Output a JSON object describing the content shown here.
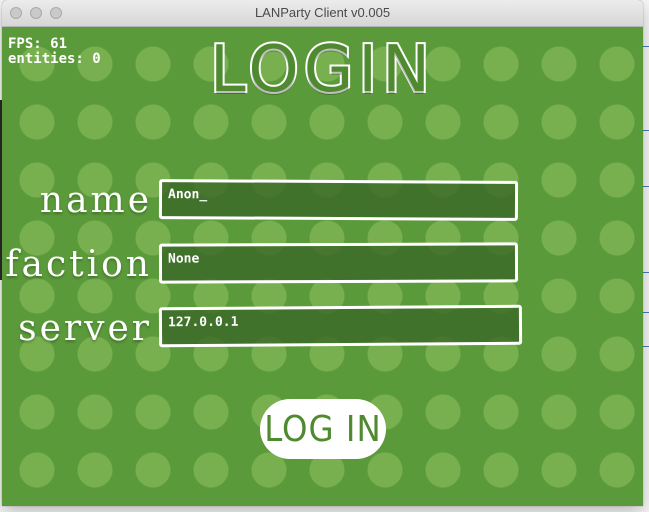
{
  "window": {
    "title": "LANParty Client v0.005"
  },
  "hud": {
    "fps_line": "FPS: 61",
    "entities_line": "entities: 0"
  },
  "heading": "LOGIN",
  "form": {
    "name": {
      "label": "name",
      "value": "Anon_"
    },
    "faction": {
      "label": "faction",
      "value": "None"
    },
    "server": {
      "label": "server",
      "value": "127.0.0.1"
    }
  },
  "login_button": {
    "label": "LOG IN"
  },
  "colors": {
    "background_green": "#5a9a3a",
    "dot_green": "#78b04f",
    "accent_green": "#4f8a30",
    "field_bg": "#3c6928"
  }
}
